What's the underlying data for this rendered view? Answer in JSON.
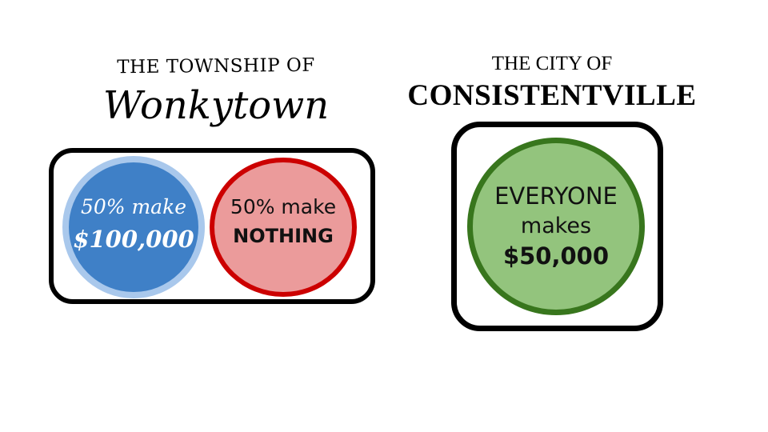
{
  "colors": {
    "background": "#ffffff",
    "outline": "#000000",
    "blue_fill": "#3f80c7",
    "blue_ring": "#a9c8ec",
    "red_fill": "#eb9b9b",
    "red_ring": "#cc0000",
    "green_fill": "#93c47d",
    "green_ring": "#38761d"
  },
  "left": {
    "prefix": "THE TOWNSHIP OF",
    "name": "Wonkytown",
    "group1": {
      "line1": "50% make",
      "line2": "$100,000"
    },
    "group2": {
      "line1": "50% make",
      "line2": "NOTHING"
    }
  },
  "right": {
    "prefix": "THE CITY OF",
    "name": "CONSISTENTVILLE",
    "group": {
      "line1": "EVERYONE",
      "line2": "makes",
      "line3": "$50,000"
    }
  }
}
